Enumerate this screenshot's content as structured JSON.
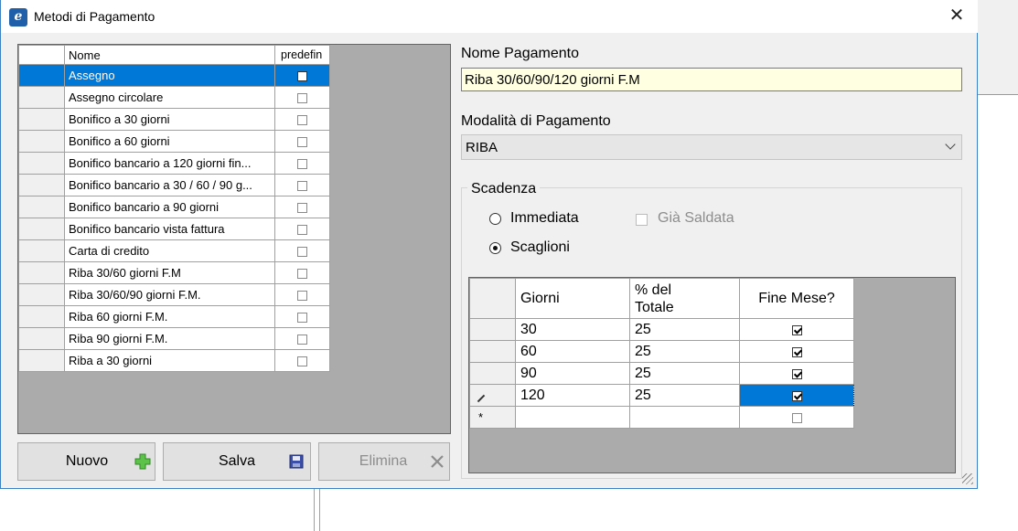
{
  "window": {
    "title": "Metodi di Pagamento",
    "close": "✕",
    "app_icon": "e"
  },
  "methods_grid": {
    "columns": [
      "Nome",
      "predefin"
    ],
    "rows": [
      {
        "name": "Assegno",
        "default": false,
        "selected": true
      },
      {
        "name": "Assegno circolare",
        "default": false
      },
      {
        "name": "Bonifico a 30 giorni",
        "default": false
      },
      {
        "name": "Bonifico a 60 giorni",
        "default": false
      },
      {
        "name": "Bonifico bancario a 120 giorni fin...",
        "default": false
      },
      {
        "name": "Bonifico bancario a 30 / 60 / 90 g...",
        "default": false
      },
      {
        "name": "Bonifico bancario a 90 giorni",
        "default": false
      },
      {
        "name": "Bonifico bancario vista fattura",
        "default": false
      },
      {
        "name": "Carta di credito",
        "default": false
      },
      {
        "name": "Riba 30/60 giorni F.M",
        "default": false
      },
      {
        "name": "Riba 30/60/90 giorni F.M.",
        "default": false
      },
      {
        "name": "Riba 60 giorni F.M.",
        "default": false
      },
      {
        "name": "Riba 90 giorni F.M.",
        "default": false
      },
      {
        "name": "Riba a 30 giorni",
        "default": false
      }
    ]
  },
  "buttons": {
    "new": "Nuovo",
    "save": "Salva",
    "delete": "Elimina"
  },
  "form": {
    "name_label": "Nome Pagamento",
    "name_value": "Riba 30/60/90/120 giorni F.M",
    "mode_label": "Modalità di Pagamento",
    "mode_value": "RIBA",
    "due_group": "Scadenza",
    "immediate_label": "Immediata",
    "paid_label": "Già Saldata",
    "installments_label": "Scaglioni"
  },
  "installments_grid": {
    "columns": [
      "Giorni",
      "% del Totale",
      "Fine Mese?"
    ],
    "rows": [
      {
        "days": "30",
        "percent": "25",
        "end_of_month": true
      },
      {
        "days": "60",
        "percent": "25",
        "end_of_month": true
      },
      {
        "days": "90",
        "percent": "25",
        "end_of_month": true
      },
      {
        "days": "120",
        "percent": "25",
        "end_of_month": true,
        "editing": true
      }
    ],
    "new_row_marker": "*"
  },
  "colors": {
    "selection": "#0078d7",
    "input_bg": "#ffffe1",
    "grid_bg": "#ababab"
  }
}
